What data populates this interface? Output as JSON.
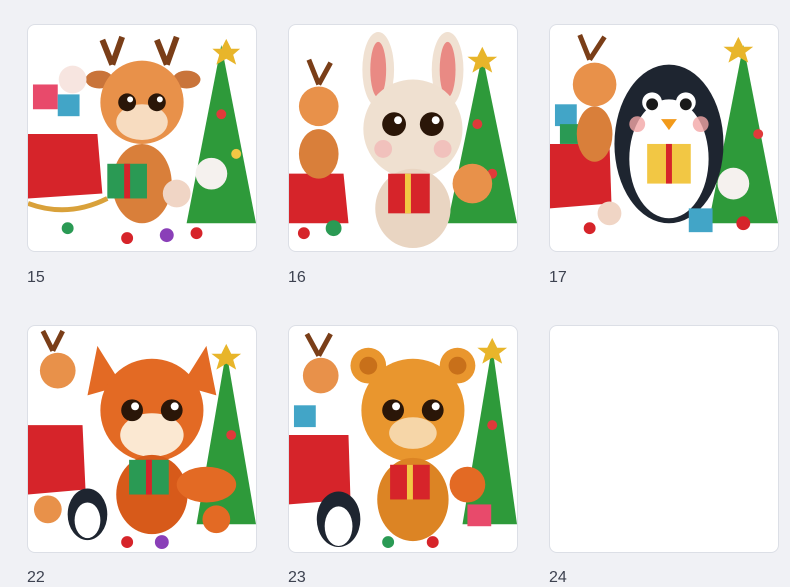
{
  "grid": {
    "items": [
      {
        "number": "15",
        "subject": "fawn-with-gift-icon",
        "bg": "#e8914a"
      },
      {
        "number": "16",
        "subject": "bunny-with-gift-icon",
        "bg": "#efe0d0"
      },
      {
        "number": "17",
        "subject": "penguin-with-gift-icon",
        "bg": "#1e2530"
      },
      {
        "number": "22",
        "subject": "fox-with-gift-icon",
        "bg": "#e36a24"
      },
      {
        "number": "23",
        "subject": "bear-cub-with-gift-icon",
        "bg": "#e9962e"
      },
      {
        "number": "24",
        "subject": "blank",
        "bg": "#ffffff"
      }
    ]
  }
}
